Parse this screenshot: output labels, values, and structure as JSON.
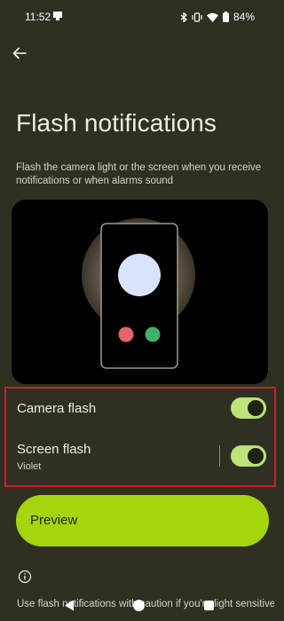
{
  "status_bar": {
    "time": "11:52",
    "battery": "84%",
    "icons": [
      "bluetooth-icon",
      "vibrate-icon",
      "wifi-icon",
      "battery-icon"
    ]
  },
  "header": {
    "back_icon": "arrow-left-icon",
    "title": "Flash notifications",
    "description": "Flash the camera light or the screen when you receive notifications or when alarms sound"
  },
  "options": [
    {
      "label": "Camera flash",
      "sublabel": "",
      "enabled": true
    },
    {
      "label": "Screen flash",
      "sublabel": "Violet",
      "enabled": true
    }
  ],
  "preview": {
    "label": "Preview"
  },
  "footer": {
    "info_icon": "info-icon",
    "text": "Use flash notifications with caution if you're light sensitive"
  },
  "nav_bar": {
    "icons": [
      "nav-back-icon",
      "nav-home-icon",
      "nav-recents-icon"
    ]
  },
  "colors": {
    "background": "#2f3022",
    "toggle_on": "#bde27a",
    "preview_button": "#a6d40d",
    "highlight_border": "#d21f25"
  }
}
